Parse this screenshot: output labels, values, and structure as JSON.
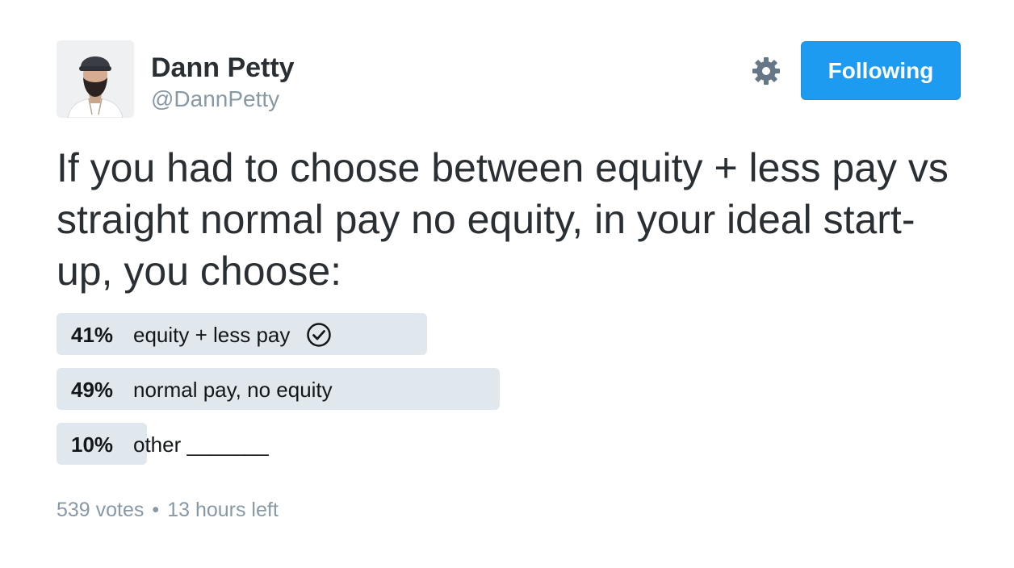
{
  "user": {
    "name": "Dann Petty",
    "handle": "@DannPetty",
    "avatar_icon": "user-photo"
  },
  "actions": {
    "settings_icon": "gear-icon",
    "follow_label": "Following",
    "follow_color": "#1d9bf0"
  },
  "tweet": {
    "text": "If you had to choose between equity + less pay vs straight normal pay no equity, in your ideal start-up, you choose:"
  },
  "poll": {
    "choices": [
      {
        "percent_label": "41%",
        "percent": 41,
        "label": "equity + less pay",
        "selected": true
      },
      {
        "percent_label": "49%",
        "percent": 49,
        "label": "normal pay, no equity",
        "selected": false
      },
      {
        "percent_label": "10%",
        "percent": 10,
        "label": "other _______",
        "selected": false
      }
    ],
    "bar_color": "#e1e8ed",
    "votes": "539 votes",
    "separator": "•",
    "time_left": "13 hours left"
  }
}
